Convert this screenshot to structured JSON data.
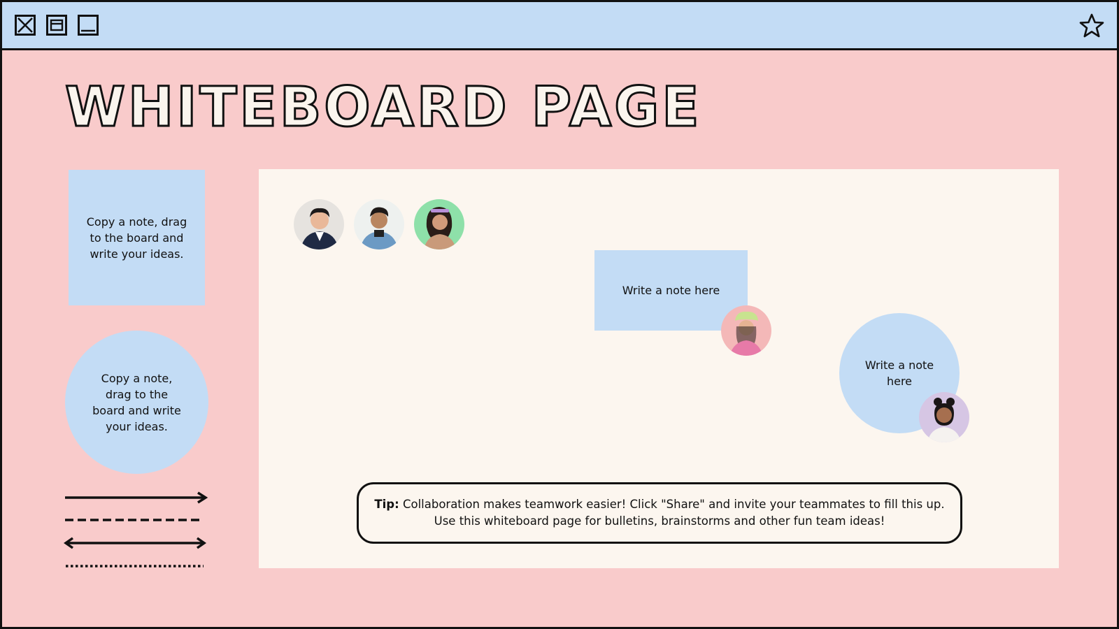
{
  "window": {
    "buttons": [
      "close",
      "maximize",
      "minimize"
    ],
    "favorite_icon": "star-icon"
  },
  "page": {
    "title": "WHITEBOARD PAGE"
  },
  "palette": {
    "square_note": "Copy a note, drag to the board and write your ideas.",
    "circle_note": "Copy a note, drag to the board and write your ideas.",
    "lines": [
      "solid-arrow",
      "dashed-line",
      "double-arrow",
      "dotted-line"
    ]
  },
  "board": {
    "note_rect": "Write a note here",
    "note_circle": "Write a note here",
    "tip": {
      "label": "Tip:",
      "line1": " Collaboration makes teamwork easier! Click \"Share\" and invite your teammates to fill this up.",
      "line2": "Use this whiteboard page for bulletins, brainstorms and other fun team ideas!"
    }
  },
  "colors": {
    "background": "#f9cbcb",
    "titlebar": "#c3dcf5",
    "board": "#fcf6ef",
    "note": "#c3dcf5",
    "ink": "#111111"
  }
}
